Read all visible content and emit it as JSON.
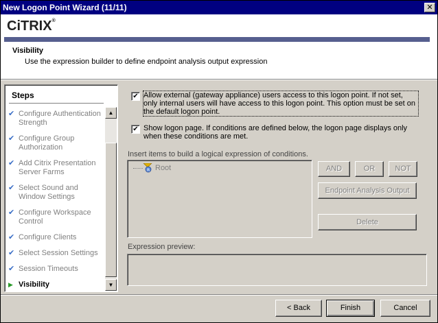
{
  "window": {
    "title": "New Logon Point Wizard (11/11)",
    "close_glyph": "✕"
  },
  "header": {
    "logo_text": "CiTRIX",
    "logo_mark": "®",
    "title": "Visibility",
    "description": "Use the expression builder to define endpoint analysis output expression",
    "brand_bar_color": "#565f8f"
  },
  "steps": {
    "title": "Steps",
    "items": [
      {
        "label": "Configure Authentication Strength",
        "state": "done"
      },
      {
        "label": "Configure Group Authorization",
        "state": "done"
      },
      {
        "label": "Add Citrix Presentation Server Farms",
        "state": "done"
      },
      {
        "label": "Select Sound and Window Settings",
        "state": "done"
      },
      {
        "label": "Configure Workspace Control",
        "state": "done"
      },
      {
        "label": "Configure Clients",
        "state": "done"
      },
      {
        "label": "Select Session Settings",
        "state": "done"
      },
      {
        "label": "Session Timeouts",
        "state": "done"
      },
      {
        "label": "Visibility",
        "state": "current"
      }
    ],
    "done_icon": "✔",
    "current_icon": "▶"
  },
  "options": {
    "allow_external": {
      "checked": true,
      "label": "Allow external (gateway appliance) users access to this logon point. If not set, only internal users will have access to this logon point. This option must be set on the default logon point."
    },
    "show_logon_page": {
      "checked": true,
      "label": "Show logon page. If conditions are defined below, the logon page displays only when these conditions are met."
    }
  },
  "expression": {
    "insert_label": "Insert items to build a logical expression of conditions.",
    "tree_root": "Root",
    "buttons": {
      "and": "AND",
      "or": "OR",
      "not": "NOT",
      "endpoint": "Endpoint Analysis Output",
      "delete": "Delete"
    },
    "preview_label": "Expression preview:",
    "preview_value": ""
  },
  "footer": {
    "back": "< Back",
    "finish": "Finish",
    "cancel": "Cancel"
  },
  "colors": {
    "titlebar": "#000080",
    "check_blue": "#3a6ec6",
    "arrow_green": "#2a9a2a"
  }
}
